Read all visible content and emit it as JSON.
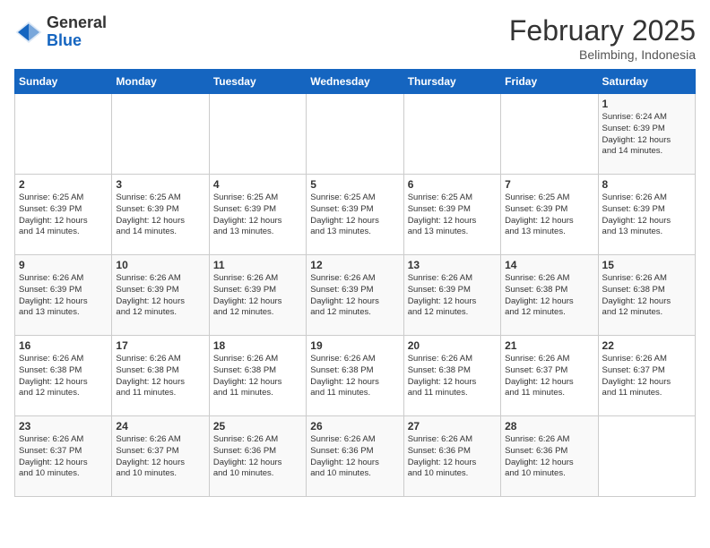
{
  "header": {
    "logo_general": "General",
    "logo_blue": "Blue",
    "month_year": "February 2025",
    "location": "Belimbing, Indonesia"
  },
  "days_of_week": [
    "Sunday",
    "Monday",
    "Tuesday",
    "Wednesday",
    "Thursday",
    "Friday",
    "Saturday"
  ],
  "weeks": [
    [
      {
        "day": "",
        "info": ""
      },
      {
        "day": "",
        "info": ""
      },
      {
        "day": "",
        "info": ""
      },
      {
        "day": "",
        "info": ""
      },
      {
        "day": "",
        "info": ""
      },
      {
        "day": "",
        "info": ""
      },
      {
        "day": "1",
        "info": "Sunrise: 6:24 AM\nSunset: 6:39 PM\nDaylight: 12 hours\nand 14 minutes."
      }
    ],
    [
      {
        "day": "2",
        "info": "Sunrise: 6:25 AM\nSunset: 6:39 PM\nDaylight: 12 hours\nand 14 minutes."
      },
      {
        "day": "3",
        "info": "Sunrise: 6:25 AM\nSunset: 6:39 PM\nDaylight: 12 hours\nand 14 minutes."
      },
      {
        "day": "4",
        "info": "Sunrise: 6:25 AM\nSunset: 6:39 PM\nDaylight: 12 hours\nand 13 minutes."
      },
      {
        "day": "5",
        "info": "Sunrise: 6:25 AM\nSunset: 6:39 PM\nDaylight: 12 hours\nand 13 minutes."
      },
      {
        "day": "6",
        "info": "Sunrise: 6:25 AM\nSunset: 6:39 PM\nDaylight: 12 hours\nand 13 minutes."
      },
      {
        "day": "7",
        "info": "Sunrise: 6:25 AM\nSunset: 6:39 PM\nDaylight: 12 hours\nand 13 minutes."
      },
      {
        "day": "8",
        "info": "Sunrise: 6:26 AM\nSunset: 6:39 PM\nDaylight: 12 hours\nand 13 minutes."
      }
    ],
    [
      {
        "day": "9",
        "info": "Sunrise: 6:26 AM\nSunset: 6:39 PM\nDaylight: 12 hours\nand 13 minutes."
      },
      {
        "day": "10",
        "info": "Sunrise: 6:26 AM\nSunset: 6:39 PM\nDaylight: 12 hours\nand 12 minutes."
      },
      {
        "day": "11",
        "info": "Sunrise: 6:26 AM\nSunset: 6:39 PM\nDaylight: 12 hours\nand 12 minutes."
      },
      {
        "day": "12",
        "info": "Sunrise: 6:26 AM\nSunset: 6:39 PM\nDaylight: 12 hours\nand 12 minutes."
      },
      {
        "day": "13",
        "info": "Sunrise: 6:26 AM\nSunset: 6:39 PM\nDaylight: 12 hours\nand 12 minutes."
      },
      {
        "day": "14",
        "info": "Sunrise: 6:26 AM\nSunset: 6:38 PM\nDaylight: 12 hours\nand 12 minutes."
      },
      {
        "day": "15",
        "info": "Sunrise: 6:26 AM\nSunset: 6:38 PM\nDaylight: 12 hours\nand 12 minutes."
      }
    ],
    [
      {
        "day": "16",
        "info": "Sunrise: 6:26 AM\nSunset: 6:38 PM\nDaylight: 12 hours\nand 12 minutes."
      },
      {
        "day": "17",
        "info": "Sunrise: 6:26 AM\nSunset: 6:38 PM\nDaylight: 12 hours\nand 11 minutes."
      },
      {
        "day": "18",
        "info": "Sunrise: 6:26 AM\nSunset: 6:38 PM\nDaylight: 12 hours\nand 11 minutes."
      },
      {
        "day": "19",
        "info": "Sunrise: 6:26 AM\nSunset: 6:38 PM\nDaylight: 12 hours\nand 11 minutes."
      },
      {
        "day": "20",
        "info": "Sunrise: 6:26 AM\nSunset: 6:38 PM\nDaylight: 12 hours\nand 11 minutes."
      },
      {
        "day": "21",
        "info": "Sunrise: 6:26 AM\nSunset: 6:37 PM\nDaylight: 12 hours\nand 11 minutes."
      },
      {
        "day": "22",
        "info": "Sunrise: 6:26 AM\nSunset: 6:37 PM\nDaylight: 12 hours\nand 11 minutes."
      }
    ],
    [
      {
        "day": "23",
        "info": "Sunrise: 6:26 AM\nSunset: 6:37 PM\nDaylight: 12 hours\nand 10 minutes."
      },
      {
        "day": "24",
        "info": "Sunrise: 6:26 AM\nSunset: 6:37 PM\nDaylight: 12 hours\nand 10 minutes."
      },
      {
        "day": "25",
        "info": "Sunrise: 6:26 AM\nSunset: 6:36 PM\nDaylight: 12 hours\nand 10 minutes."
      },
      {
        "day": "26",
        "info": "Sunrise: 6:26 AM\nSunset: 6:36 PM\nDaylight: 12 hours\nand 10 minutes."
      },
      {
        "day": "27",
        "info": "Sunrise: 6:26 AM\nSunset: 6:36 PM\nDaylight: 12 hours\nand 10 minutes."
      },
      {
        "day": "28",
        "info": "Sunrise: 6:26 AM\nSunset: 6:36 PM\nDaylight: 12 hours\nand 10 minutes."
      },
      {
        "day": "",
        "info": ""
      }
    ]
  ]
}
